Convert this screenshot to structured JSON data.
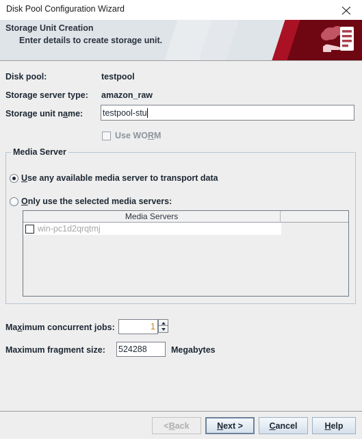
{
  "window": {
    "title": "Disk Pool Configuration Wizard",
    "close_icon": "close-icon"
  },
  "banner": {
    "title": "Storage Unit Creation",
    "subtitle": "Enter details to create storage unit.",
    "icon": "cloud-server-hand-icon",
    "accent_color": "#6e0712",
    "accent_light": "#ab1124",
    "background": "#dfe4e9"
  },
  "form": {
    "disk_pool_label": "Disk pool:",
    "disk_pool_value": "testpool",
    "storage_server_type_label": "Storage server type:",
    "storage_server_type_value": "amazon_raw",
    "storage_unit_name_label_pre": "Storage unit n",
    "storage_unit_name_label_mn": "a",
    "storage_unit_name_label_post": "me:",
    "storage_unit_name_value": "testpool-stu",
    "use_worm_label_pre": "Use WO",
    "use_worm_label_mn": "R",
    "use_worm_label_post": "M",
    "use_worm_checked": false,
    "use_worm_enabled": false
  },
  "media_server": {
    "group_title": "Media Server",
    "radio_any_pre": "",
    "radio_any_mn": "U",
    "radio_any_post": "se any available media server to transport data",
    "radio_selected_pre": "",
    "radio_selected_mn": "O",
    "radio_selected_post": "nly use the selected media servers:",
    "selected_option": "use_any",
    "table": {
      "columns": [
        "Media Servers",
        ""
      ],
      "rows": [
        {
          "checked": false,
          "name": "win-pc1d2qrqtmj",
          "enabled": false
        }
      ]
    }
  },
  "limits": {
    "max_jobs_label_pre": "Ma",
    "max_jobs_label_mn": "x",
    "max_jobs_label_post": "imum concurrent jobs:",
    "max_jobs_value": "1",
    "max_fragment_label": "Maximum fragment size:",
    "max_fragment_value": "524288",
    "max_fragment_units": "Megabytes"
  },
  "footer": {
    "back_pre": "< ",
    "back_mn": "B",
    "back_post": "ack",
    "back_enabled": false,
    "next_pre": "",
    "next_mn": "N",
    "next_post": "ext >",
    "next_default": true,
    "cancel_pre": "",
    "cancel_mn": "C",
    "cancel_post": "ancel",
    "help_pre": "",
    "help_mn": "H",
    "help_post": "elp"
  }
}
